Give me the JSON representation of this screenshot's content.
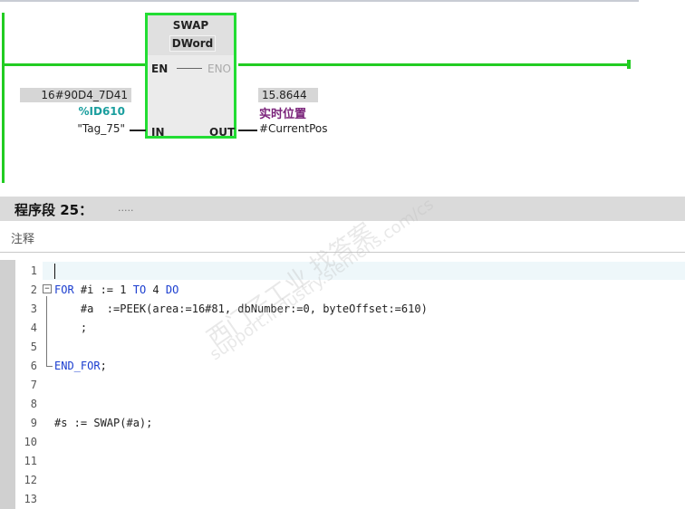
{
  "ladder": {
    "block": {
      "title": "SWAP",
      "type": "DWord",
      "en": "EN",
      "eno": "ENO",
      "in": "IN",
      "out": "OUT"
    },
    "input": {
      "value": "16#90D4_7D41",
      "address": "%ID610",
      "operand": "\"Tag_75\""
    },
    "output": {
      "value": "15.8644",
      "tag_label": "实时位置",
      "operand": "#CurrentPos"
    }
  },
  "network": {
    "title": "程序段 25：",
    "dots": "....."
  },
  "comment": {
    "label": "注释"
  },
  "editor": {
    "line_numbers": [
      "1",
      "2",
      "3",
      "4",
      "5",
      "6",
      "7",
      "8",
      "9",
      "10",
      "11",
      "12",
      "13"
    ],
    "lines": {
      "l2_kw_for": "FOR",
      "l2_var": " #i := 1 ",
      "l2_kw_to": "TO",
      "l2_mid": " 4 ",
      "l2_kw_do": "DO",
      "l3_code": "    #a  :=PEEK(area:=16#81, dbNumber:=0, byteOffset:=610)",
      "l4_code": "    ;",
      "l6_kw_endfor": "END_FOR",
      "l6_tail": ";",
      "l9_code": "#s := SWAP(#a);"
    }
  },
  "watermark": {
    "line1": "西门子工业  找答案",
    "line2": "support.industry.siemens.com/cs"
  },
  "colors": {
    "rail_green": "#22cc22",
    "keyword_blue": "#1a3dcf",
    "address_teal": "#1a9e9e",
    "tag_purple": "#7a237a"
  }
}
